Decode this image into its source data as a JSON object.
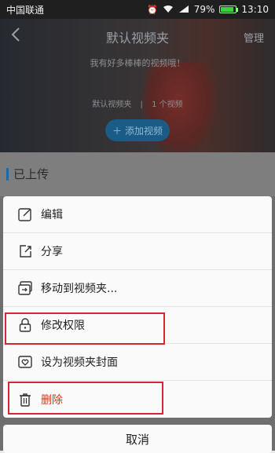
{
  "status_bar": {
    "carrier": "中国联通",
    "signal_label": "4G",
    "battery": "79%",
    "battery_level": 0.79,
    "time": "13:10"
  },
  "header": {
    "back_icon": "chevron-left-icon",
    "title": "默认视频夹",
    "manage_label": "管理"
  },
  "cover": {
    "description": "我有好多棒棒的视频哦！",
    "folder_name": "默认视频夹",
    "separator": "|",
    "video_count": "1 个视频",
    "add_button": {
      "icon": "plus-icon",
      "label": "添加视频"
    }
  },
  "section": {
    "title": "已上传"
  },
  "action_sheet": {
    "items": [
      {
        "label": "编辑",
        "icon": "edit-icon"
      },
      {
        "label": "分享",
        "icon": "share-icon"
      },
      {
        "label": "移动到视频夹...",
        "icon": "move-folder-icon"
      },
      {
        "label": "修改权限",
        "icon": "lock-icon"
      },
      {
        "label": "设为视频夹封面",
        "icon": "cover-heart-icon"
      },
      {
        "label": "删除",
        "icon": "trash-icon"
      }
    ],
    "cancel_label": "取消"
  },
  "colors": {
    "accent": "#1d6aa8",
    "delete": "#d2361b",
    "highlight_box": "#d7262e"
  }
}
